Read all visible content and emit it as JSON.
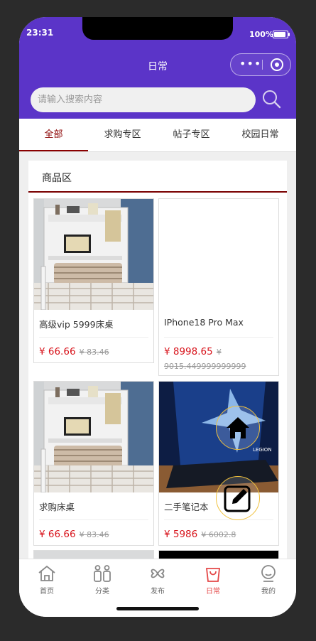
{
  "status": {
    "time": "23:31",
    "battery": "100%"
  },
  "nav": {
    "title": "日常"
  },
  "search": {
    "placeholder": "请输入搜索内容"
  },
  "tabs": [
    {
      "label": "全部",
      "active": true
    },
    {
      "label": "求购专区"
    },
    {
      "label": "帖子专区"
    },
    {
      "label": "校园日常"
    }
  ],
  "section": {
    "title": "商品区"
  },
  "products": [
    {
      "name": "高级vip 5999床桌",
      "price": "¥ 66.66",
      "old_price": "¥ 83.46",
      "image": "bed-desk"
    },
    {
      "name": "IPhone18 Pro Max",
      "price": "¥ 8998.65",
      "old_price": "¥ 9015.449999999999",
      "image": "blank"
    },
    {
      "name": "求购床桌",
      "price": "¥ 66.66",
      "old_price": "¥ 83.46",
      "image": "bed-desk"
    },
    {
      "name": "二手笔记本",
      "price": "¥ 5986",
      "old_price": "¥ 6002.8",
      "image": "laptop"
    }
  ],
  "fabs": [
    {
      "icon": "home-icon"
    },
    {
      "icon": "edit-icon"
    }
  ],
  "tabbar": [
    {
      "label": "首页",
      "icon": "home-icon"
    },
    {
      "label": "分类",
      "icon": "category-icon"
    },
    {
      "label": "发布",
      "icon": "publish-icon"
    },
    {
      "label": "日常",
      "icon": "bag-icon",
      "active": true
    },
    {
      "label": "我的",
      "icon": "profile-icon"
    }
  ],
  "colors": {
    "header": "#5b34c8",
    "accent": "#8b0000",
    "price": "#d8141c",
    "active_tab": "#e44747"
  }
}
